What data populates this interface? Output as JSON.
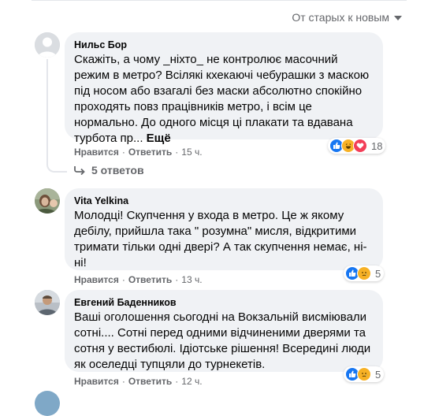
{
  "sort": {
    "label": "От старых к новым"
  },
  "comments": [
    {
      "author": "Нильс Бор",
      "text": "Скажіть, а чому _ніхто_ не контролює масочний режим в метро? Всілякі кхекаючі чебурашки з маскою під носом або взагалі без маски абсолютно спокійно проходять повз працівників метро, і всім це нормально. До одного місця ці плакати та вдавана турбота пр... ",
      "more": "Ещё",
      "like": "Нравится",
      "reply": "Ответить",
      "time": "15 ч.",
      "reactions": [
        "like-icon",
        "haha-icon",
        "love-icon"
      ],
      "reaction_count": "18",
      "replies_label": "5 ответов"
    },
    {
      "author": "Vita Yelkina",
      "text": "Молодці! Скупчення у входа в метро. Це ж якому дебілу, прийшла така \" розумна\" мисля, відкритими тримати тільки одні двері? А так скупчення немає, ні-ні!",
      "like": "Нравится",
      "reply": "Ответить",
      "time": "13 ч.",
      "reactions": [
        "like-icon",
        "sad-icon"
      ],
      "reaction_count": "5"
    },
    {
      "author": "Евгений Баденников",
      "text": "Ваші оголошення сьогодні на Вокзальній висміювали сотні.... Сотні перед одними відчиненими дверями та сотня у вестибюлі. Ідіотське рішення! Всередині люди як оселедці тупцяли до турнекетів.",
      "like": "Нравится",
      "reply": "Ответить",
      "time": "12 ч.",
      "reactions": [
        "like-icon",
        "sad-icon"
      ],
      "reaction_count": "5"
    }
  ],
  "colors": {
    "bubble": "#f0f2f5",
    "secondary_text": "#65676b",
    "like": "#1877f2",
    "love": "#f33e58",
    "haha": "#f7b125"
  }
}
